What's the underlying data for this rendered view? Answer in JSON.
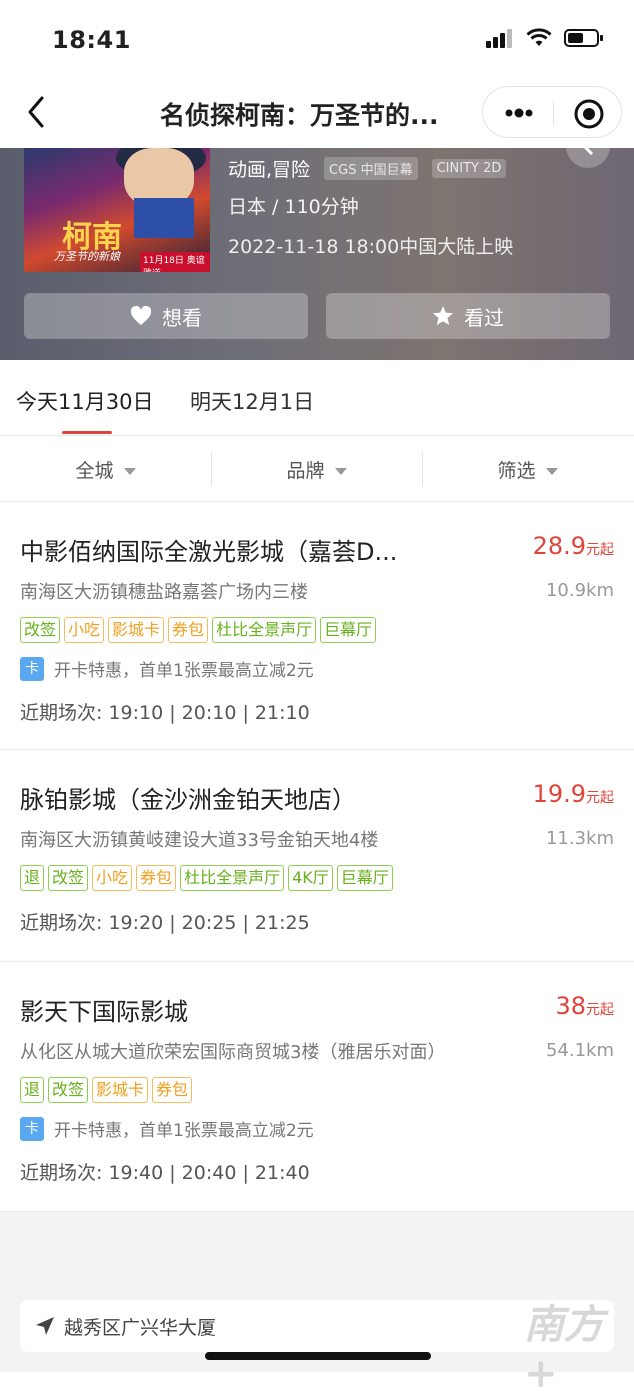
{
  "status_bar": {
    "time": "18:41"
  },
  "nav": {
    "title": "名侦探柯南：万圣节的..."
  },
  "movie": {
    "poster_title": "柯南",
    "poster_subtitle": "万圣节的新娘",
    "poster_date": "11月18日 奥谊雅道",
    "genre": "动画,冒险",
    "badges": [
      "CGS 中国巨幕",
      "CINITY 2D"
    ],
    "region_length": "日本 / 110分钟",
    "release": "2022-11-18 18:00中国大陆上映",
    "want_label": "想看",
    "seen_label": "看过"
  },
  "tabs": [
    {
      "label": "今天11月30日",
      "active": true
    },
    {
      "label": "明天12月1日",
      "active": false
    }
  ],
  "filters": [
    "全城",
    "品牌",
    "筛选"
  ],
  "cinemas": [
    {
      "name": "中影佰纳国际全激光影城（嘉荟D...",
      "price": "28.9",
      "price_unit": "元起",
      "address": "南海区大沥镇穗盐路嘉荟广场内三楼",
      "distance": "10.9km",
      "tags": [
        {
          "label": "改签",
          "color": "green"
        },
        {
          "label": "小吃",
          "color": "orange"
        },
        {
          "label": "影城卡",
          "color": "orange"
        },
        {
          "label": "券包",
          "color": "orange"
        },
        {
          "label": "杜比全景声厅",
          "color": "green"
        },
        {
          "label": "巨幕厅",
          "color": "green"
        }
      ],
      "promo": "开卡特惠，首单1张票最高立减2元",
      "sessions": "近期场次: 19:10 | 20:10 | 21:10"
    },
    {
      "name": "脉铂影城（金沙洲金铂天地店）",
      "price": "19.9",
      "price_unit": "元起",
      "address": "南海区大沥镇黄岐建设大道33号金铂天地4楼",
      "distance": "11.3km",
      "tags": [
        {
          "label": "退",
          "color": "green"
        },
        {
          "label": "改签",
          "color": "green"
        },
        {
          "label": "小吃",
          "color": "orange"
        },
        {
          "label": "券包",
          "color": "orange"
        },
        {
          "label": "杜比全景声厅",
          "color": "green"
        },
        {
          "label": "4K厅",
          "color": "green"
        },
        {
          "label": "巨幕厅",
          "color": "green"
        }
      ],
      "promo": "",
      "sessions": "近期场次: 19:20 | 20:25 | 21:25"
    },
    {
      "name": "影天下国际影城",
      "price": "38",
      "price_unit": "元起",
      "address": "从化区从城大道欣荣宏国际商贸城3楼（雅居乐对面）",
      "distance": "54.1km",
      "tags": [
        {
          "label": "退",
          "color": "green"
        },
        {
          "label": "改签",
          "color": "green"
        },
        {
          "label": "影城卡",
          "color": "orange"
        },
        {
          "label": "券包",
          "color": "orange"
        }
      ],
      "promo": "开卡特惠，首单1张票最高立减2元",
      "sessions": "近期场次: 19:40 | 20:40 | 21:40"
    }
  ],
  "card_badge": "卡",
  "location": "越秀区广兴华大厦",
  "watermark": "南方+",
  "colors": {
    "accent": "#e0443a",
    "tag_green": "#67b11c",
    "tag_orange": "#f0a020",
    "card_blue": "#5aa8f0"
  }
}
